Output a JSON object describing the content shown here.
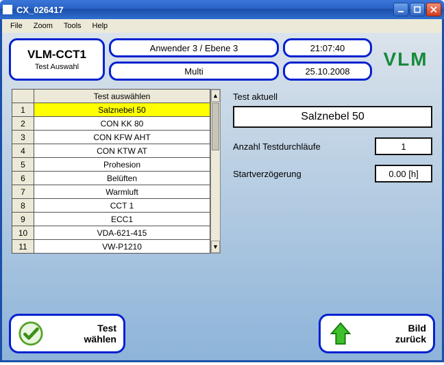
{
  "window": {
    "title": "CX_026417"
  },
  "menu": {
    "file": "File",
    "zoom": "Zoom",
    "tools": "Tools",
    "help": "Help"
  },
  "header": {
    "product": "VLM-CCT1",
    "subtitle": "Test Auswahl",
    "user_level": "Anwender 3 / Ebene 3",
    "time": "21:07:40",
    "mode": "Multi",
    "date": "25.10.2008",
    "logo": "VLM"
  },
  "table": {
    "header": "Test auswählen",
    "rows": [
      {
        "n": "1",
        "name": "Salznebel 50",
        "selected": true
      },
      {
        "n": "2",
        "name": "CON KK 80",
        "selected": false
      },
      {
        "n": "3",
        "name": "CON KFW AHT",
        "selected": false
      },
      {
        "n": "4",
        "name": "CON KTW AT",
        "selected": false
      },
      {
        "n": "5",
        "name": "Prohesion",
        "selected": false
      },
      {
        "n": "6",
        "name": "Belüften",
        "selected": false
      },
      {
        "n": "7",
        "name": "Warmluft",
        "selected": false
      },
      {
        "n": "8",
        "name": "CCT 1",
        "selected": false
      },
      {
        "n": "9",
        "name": "ECC1",
        "selected": false
      },
      {
        "n": "10",
        "name": "VDA-621-415",
        "selected": false
      },
      {
        "n": "11",
        "name": "VW-P1210",
        "selected": false
      }
    ]
  },
  "right": {
    "current_label": "Test aktuell",
    "current_test": "Salznebel 50",
    "runs_label": "Anzahl Testdurchläufe",
    "runs_value": "1",
    "delay_label": "Startverzögerung",
    "delay_value": "0.00  [h]"
  },
  "buttons": {
    "select_l1": "Test",
    "select_l2": "wählen",
    "back_l1": "Bild",
    "back_l2": "zurück"
  }
}
